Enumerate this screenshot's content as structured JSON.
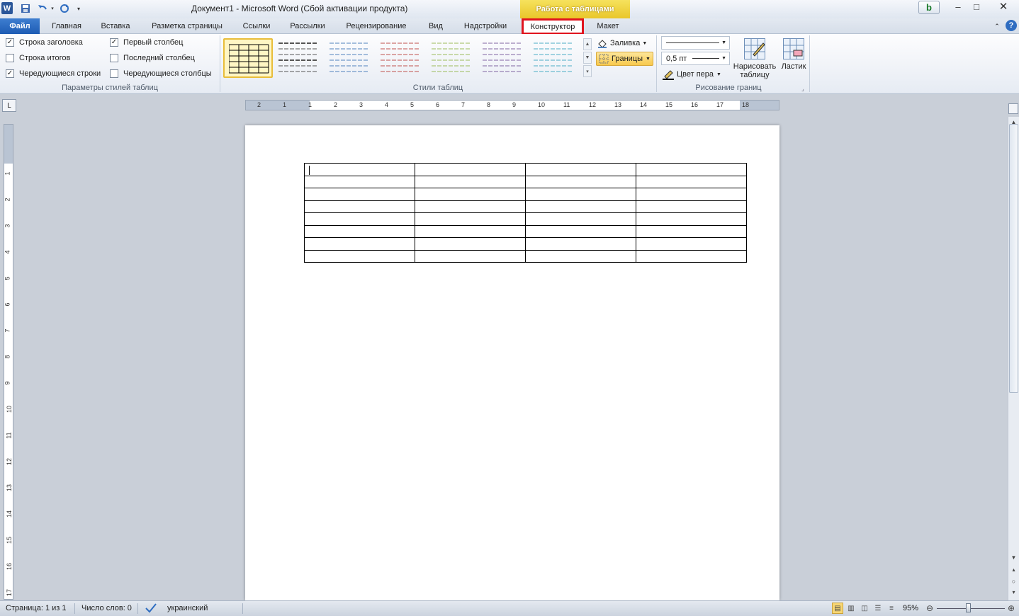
{
  "window": {
    "title": "Документ1  -  Microsoft Word (Сбой активации продукта)",
    "context_header": "Работа с таблицами",
    "word_logo": "W",
    "bing_label": "b",
    "icons": [
      "word-icon",
      "save-icon",
      "undo-icon",
      "redo-icon",
      "customize-qat-icon",
      "minimize-icon",
      "maximize-icon",
      "close-icon"
    ]
  },
  "tabs": {
    "file": "Файл",
    "home": "Главная",
    "insert": "Вставка",
    "layout": "Разметка страницы",
    "refs": "Ссылки",
    "mailings": "Рассылки",
    "review": "Рецензирование",
    "view": "Вид",
    "addins": "Надстройки",
    "design": "Конструктор",
    "table_layout": "Макет",
    "help": "?"
  },
  "ribbon": {
    "style_options": {
      "label": "Параметры стилей таблиц",
      "header_row": {
        "label": "Строка заголовка",
        "checked": true
      },
      "total_row": {
        "label": "Строка итогов",
        "checked": false
      },
      "banded_rows": {
        "label": "Чередующиеся строки",
        "checked": true
      },
      "first_column": {
        "label": "Первый столбец",
        "checked": true
      },
      "last_column": {
        "label": "Последний столбец",
        "checked": false
      },
      "banded_columns": {
        "label": "Чередующиеся столбцы",
        "checked": false
      }
    },
    "table_styles": {
      "label": "Стили таблиц",
      "swatch_colors": [
        "#000000",
        "#555555",
        "#4f81bd",
        "#c0504d",
        "#9bbb59",
        "#8064a2",
        "#4bacc6"
      ]
    },
    "shading_label": "Заливка",
    "borders_label": "Границы",
    "line_weight": "0,5 пт",
    "pen_color": "Цвет пера",
    "draw_table_line1": "Нарисовать",
    "draw_table_line2": "таблицу",
    "eraser": "Ластик",
    "draw_borders_label": "Рисование границ"
  },
  "ruler": {
    "h_numbers": [
      "2",
      "1",
      "1",
      "2",
      "3",
      "4",
      "5",
      "6",
      "7",
      "8",
      "9",
      "10",
      "11",
      "12",
      "13",
      "14",
      "15",
      "16",
      "17",
      "18"
    ],
    "v_numbers": [
      "1",
      "2",
      "3",
      "4",
      "5",
      "6",
      "7",
      "8",
      "9",
      "10",
      "11",
      "12",
      "13",
      "14",
      "15",
      "16",
      "17"
    ],
    "tab_selector": "L"
  },
  "document": {
    "table_rows": 8,
    "table_cols": 4
  },
  "status": {
    "page": "Страница: 1 из 1",
    "words": "Число слов: 0",
    "language": "украинский",
    "zoom": "95%",
    "zoom_percent": 95
  }
}
